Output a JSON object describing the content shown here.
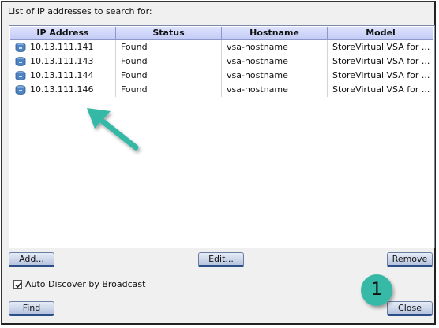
{
  "dialog": {
    "heading": "List of IP addresses to search for:"
  },
  "table": {
    "columns": [
      "IP Address",
      "Status",
      "Hostname",
      "Model"
    ],
    "rows": [
      {
        "ip": "10.13.111.141",
        "status": "Found",
        "hostname": "vsa-hostname",
        "model": "StoreVirtual VSA for ..."
      },
      {
        "ip": "10.13.111.143",
        "status": "Found",
        "hostname": "vsa-hostname",
        "model": "StoreVirtual VSA for ..."
      },
      {
        "ip": "10.13.111.144",
        "status": "Found",
        "hostname": "vsa-hostname",
        "model": "StoreVirtual VSA for ..."
      },
      {
        "ip": "10.13.111.146",
        "status": "Found",
        "hostname": "vsa-hostname",
        "model": "StoreVirtual VSA for ..."
      }
    ]
  },
  "buttons": {
    "add": "Add...",
    "edit": "Edit...",
    "remove": "Remove",
    "find": "Find",
    "close": "Close"
  },
  "auto_discover": {
    "label": "Auto Discover by Broadcast",
    "checked": true
  },
  "annotation": {
    "step_number": "1",
    "color": "#36b9a6"
  },
  "icons": {
    "row_icon": "storage-node-icon",
    "arrow": "pointer-arrow-icon"
  }
}
